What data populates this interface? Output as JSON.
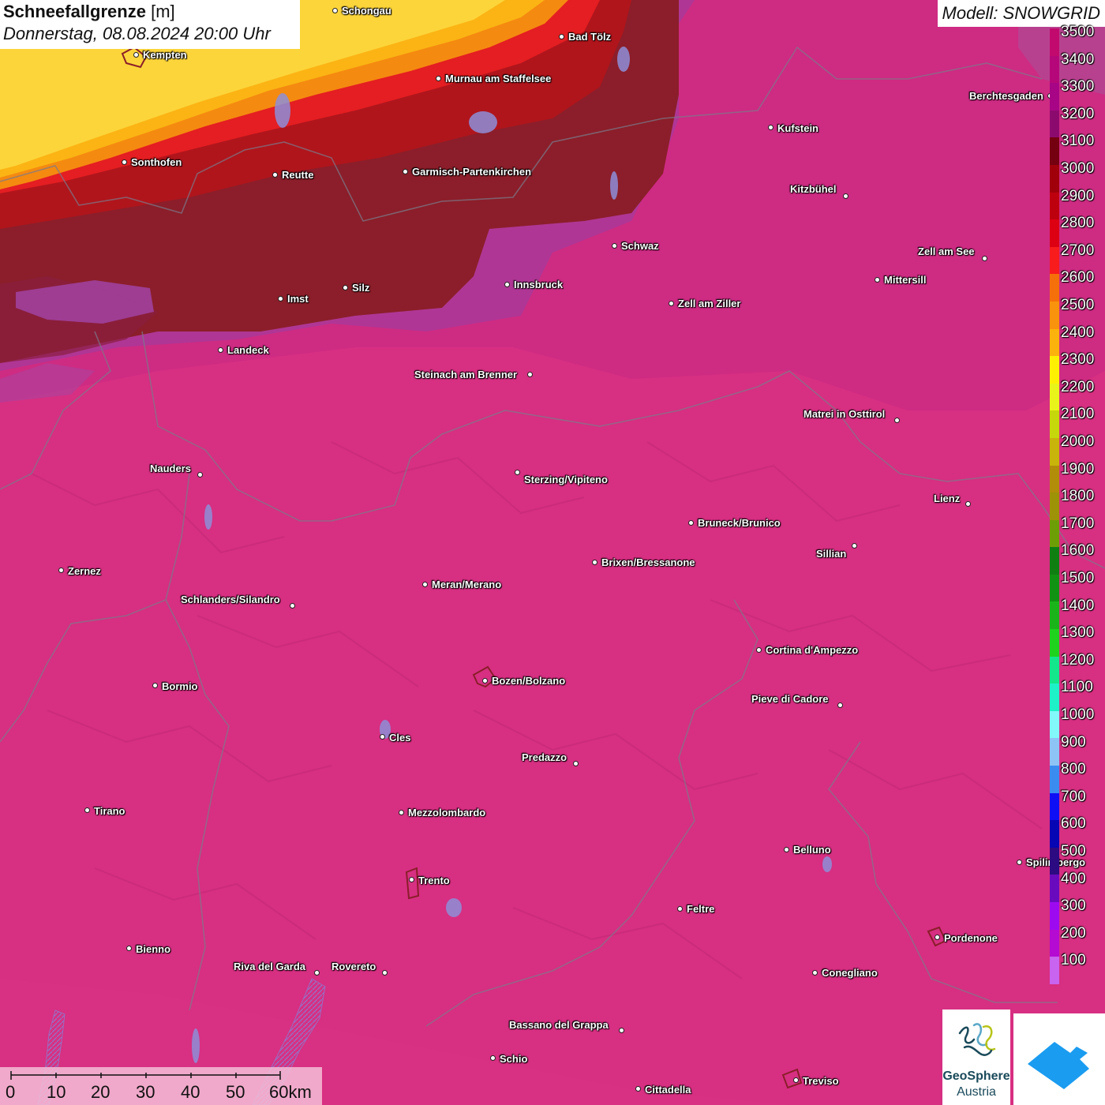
{
  "title": {
    "bold": "Schneefallgrenze",
    "unit": "[m]",
    "datetime": "Donnerstag, 08.08.2024 20:00 Uhr"
  },
  "model_label": "Modell: SNOWGRID",
  "legend": {
    "labels": [
      "3500",
      "3400",
      "3300",
      "3200",
      "3100",
      "3000",
      "2900",
      "2800",
      "2700",
      "2600",
      "2500",
      "2400",
      "2300",
      "2200",
      "2100",
      "2000",
      "1900",
      "1800",
      "1700",
      "1600",
      "1500",
      "1400",
      "1300",
      "1200",
      "1100",
      "1000",
      "900",
      "800",
      "700",
      "600",
      "500",
      "400",
      "300",
      "200",
      "100"
    ],
    "colors": [
      "#c2096e",
      "#b5077a",
      "#a70586",
      "#8c0a6e",
      "#750010",
      "#a0000a",
      "#be000e",
      "#dc0012",
      "#f81c1c",
      "#f5700a",
      "#f9920c",
      "#fbb20c",
      "#fdf003",
      "#e9f51a",
      "#c6d80b",
      "#c8b40a",
      "#b28d0a",
      "#9e9208",
      "#6e9e06",
      "#107f12",
      "#129212",
      "#1ab41a",
      "#1ed21e",
      "#14e68c",
      "#1ef0c8",
      "#82f8fa",
      "#8ec3f5",
      "#3a8cf0",
      "#0f0ff5",
      "#0606b4",
      "#2c0a82",
      "#6a0abe",
      "#9e0af0",
      "#b40ad2",
      "#c864f0"
    ]
  },
  "cities": [
    {
      "name": "Schongau",
      "dot": [
        424,
        13
      ],
      "label": [
        433,
        7
      ]
    },
    {
      "name": "Bad Tölz",
      "dot": [
        711,
        46
      ],
      "label": [
        720,
        40
      ]
    },
    {
      "name": "Kempten",
      "dot": [
        172,
        69
      ],
      "label": [
        181,
        63
      ]
    },
    {
      "name": "Murnau am Staffelsee",
      "dot": [
        555,
        99
      ],
      "label": [
        564,
        93
      ]
    },
    {
      "name": "Sonthofen",
      "dot": [
        157,
        205
      ],
      "label": [
        166,
        199
      ]
    },
    {
      "name": "Reutte",
      "dot": [
        348,
        221
      ],
      "label": [
        357,
        215
      ]
    },
    {
      "name": "Garmisch-Partenkirchen",
      "dot": [
        513,
        217
      ],
      "label": [
        522,
        211
      ]
    },
    {
      "name": "Kufstein",
      "dot": [
        976,
        161
      ],
      "label": [
        985,
        156
      ]
    },
    {
      "name": "Berchtesgaden",
      "dot": [
        1330,
        121
      ],
      "label": [
        1228,
        115
      ]
    },
    {
      "name": "Kitzbühel",
      "dot": [
        1071,
        248
      ],
      "label": [
        1001,
        233
      ]
    },
    {
      "name": "Schwaz",
      "dot": [
        778,
        311
      ],
      "label": [
        787,
        305
      ]
    },
    {
      "name": "Zell am See",
      "dot": [
        1247,
        327
      ],
      "label": [
        1163,
        312
      ]
    },
    {
      "name": "Mittersill",
      "dot": [
        1111,
        354
      ],
      "label": [
        1120,
        348
      ]
    },
    {
      "name": "Innsbruck",
      "dot": [
        642,
        360
      ],
      "label": [
        651,
        354
      ]
    },
    {
      "name": "Silz",
      "dot": [
        437,
        364
      ],
      "label": [
        446,
        358
      ]
    },
    {
      "name": "Imst",
      "dot": [
        355,
        378
      ],
      "label": [
        364,
        372
      ]
    },
    {
      "name": "Zell am Ziller",
      "dot": [
        850,
        384
      ],
      "label": [
        859,
        378
      ]
    },
    {
      "name": "Landeck",
      "dot": [
        279,
        443
      ],
      "label": [
        288,
        437
      ]
    },
    {
      "name": "Steinach am Brenner",
      "dot": [
        671,
        474
      ],
      "label": [
        525,
        468
      ]
    },
    {
      "name": "Matrei in Osttirol",
      "dot": [
        1136,
        532
      ],
      "label": [
        1018,
        518
      ]
    },
    {
      "name": "Nauders",
      "dot": [
        253,
        601
      ],
      "label": [
        190,
        587
      ]
    },
    {
      "name": "Sterzing/Vipiteno",
      "dot": [
        655,
        598
      ],
      "label": [
        664,
        601
      ]
    },
    {
      "name": "Lienz",
      "dot": [
        1226,
        638
      ],
      "label": [
        1183,
        625
      ]
    },
    {
      "name": "Bruneck/Brunico",
      "dot": [
        875,
        662
      ],
      "label": [
        884,
        656
      ]
    },
    {
      "name": "Sillian",
      "dot": [
        1082,
        691
      ],
      "label": [
        1034,
        695
      ]
    },
    {
      "name": "Brixen/Bressanone",
      "dot": [
        753,
        712
      ],
      "label": [
        762,
        706
      ]
    },
    {
      "name": "Zernez",
      "dot": [
        77,
        722
      ],
      "label": [
        86,
        717
      ]
    },
    {
      "name": "Meran/Merano",
      "dot": [
        538,
        740
      ],
      "label": [
        547,
        734
      ]
    },
    {
      "name": "Schlanders/Silandro",
      "dot": [
        370,
        767
      ],
      "label": [
        229,
        753
      ]
    },
    {
      "name": "Cortina d'Ampezzo",
      "dot": [
        961,
        823
      ],
      "label": [
        970,
        817
      ]
    },
    {
      "name": "Bozen/Bolzano",
      "dot": [
        614,
        862
      ],
      "label": [
        623,
        856
      ]
    },
    {
      "name": "Bormio",
      "dot": [
        196,
        868
      ],
      "label": [
        205,
        863
      ]
    },
    {
      "name": "Pieve di Cadore",
      "dot": [
        1064,
        893
      ],
      "label": [
        952,
        879
      ]
    },
    {
      "name": "Cles",
      "dot": [
        484,
        933
      ],
      "label": [
        493,
        928
      ]
    },
    {
      "name": "Predazzo",
      "dot": [
        729,
        967
      ],
      "label": [
        661,
        953
      ]
    },
    {
      "name": "Tirano",
      "dot": [
        110,
        1026
      ],
      "label": [
        119,
        1021
      ]
    },
    {
      "name": "Mezzolombardo",
      "dot": [
        508,
        1029
      ],
      "label": [
        517,
        1023
      ]
    },
    {
      "name": "Belluno",
      "dot": [
        996,
        1076
      ],
      "label": [
        1005,
        1070
      ]
    },
    {
      "name": "Spilimbergo",
      "dot": [
        1291,
        1092
      ],
      "label": [
        1300,
        1086
      ]
    },
    {
      "name": "Trento",
      "dot": [
        521,
        1114
      ],
      "label": [
        530,
        1109
      ]
    },
    {
      "name": "Feltre",
      "dot": [
        861,
        1151
      ],
      "label": [
        870,
        1145
      ]
    },
    {
      "name": "Pordenone",
      "dot": [
        1187,
        1187
      ],
      "label": [
        1196,
        1182
      ]
    },
    {
      "name": "Bienno",
      "dot": [
        163,
        1201
      ],
      "label": [
        172,
        1196
      ]
    },
    {
      "name": "Riva del Garda",
      "dot": [
        401,
        1232
      ],
      "label": [
        296,
        1218
      ]
    },
    {
      "name": "Rovereto",
      "dot": [
        487,
        1232
      ],
      "label": [
        420,
        1218
      ]
    },
    {
      "name": "Conegliano",
      "dot": [
        1032,
        1232
      ],
      "label": [
        1041,
        1226
      ]
    },
    {
      "name": "Bassano del Grappa",
      "dot": [
        787,
        1305
      ],
      "label": [
        645,
        1292
      ]
    },
    {
      "name": "Schio",
      "dot": [
        624,
        1340
      ],
      "label": [
        633,
        1335
      ]
    },
    {
      "name": "Treviso",
      "dot": [
        1008,
        1368
      ],
      "label": [
        1017,
        1363
      ]
    },
    {
      "name": "Cittadella",
      "dot": [
        808,
        1379
      ],
      "label": [
        817,
        1374
      ]
    }
  ],
  "scalebar": {
    "labels": [
      "0",
      "10",
      "20",
      "30",
      "40",
      "50",
      "60km"
    ]
  },
  "logos": {
    "geosphere_line1": "GeoSphere",
    "geosphere_line2": "Austria",
    "geosphere_icon": "geosphere-logo-icon",
    "snowgrid_icon": "snowgrid-logo-icon"
  }
}
